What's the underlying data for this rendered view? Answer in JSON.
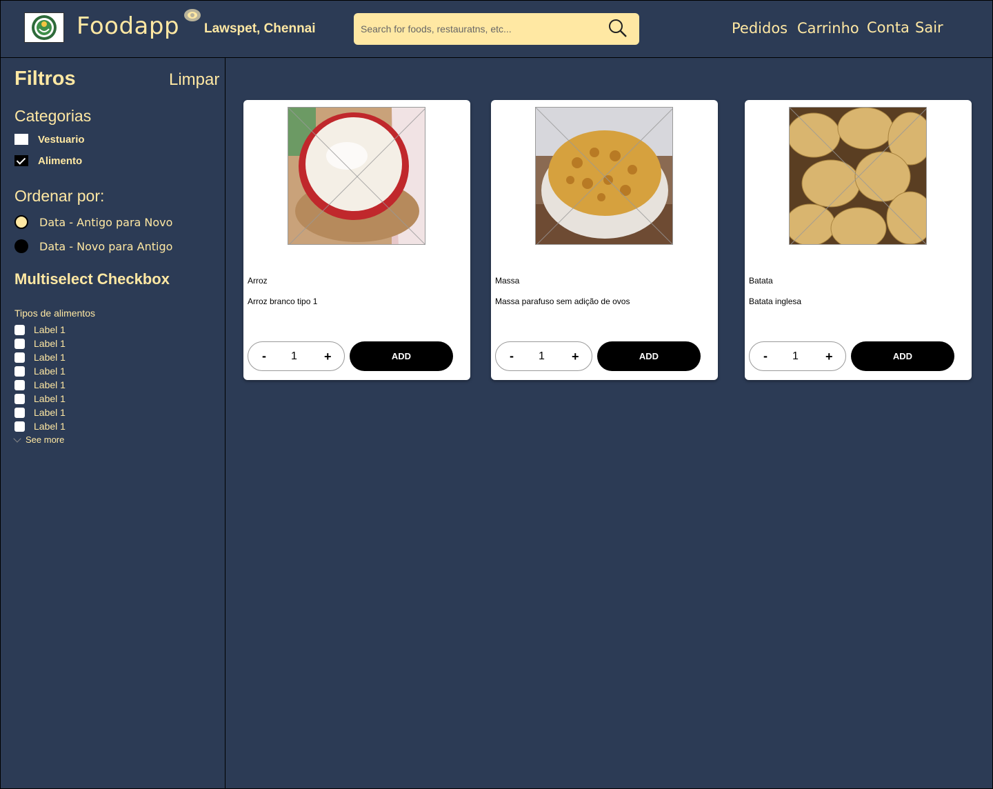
{
  "header": {
    "brand": "Foodapp",
    "location": "Lawspet, Chennai",
    "search_placeholder": "Search for foods, restauratns, etc...",
    "nav": [
      "Pedidos",
      "Carrinho",
      "Conta",
      "Sair"
    ]
  },
  "sidebar": {
    "title": "Filtros",
    "clear": "Limpar",
    "categories_title": "Categorias",
    "categories": [
      {
        "label": "Vestuario",
        "checked": false
      },
      {
        "label": "Alimento",
        "checked": true
      }
    ],
    "sort_title": "Ordenar por:",
    "sort_options": [
      {
        "label": "Data - Antigo para Novo",
        "selected": true
      },
      {
        "label": "Data - Novo para Antigo",
        "selected": false
      }
    ],
    "multiselect_title": "Multiselect Checkbox",
    "multiselect_sub": "Tipos de alimentos",
    "multiselect_items": [
      "Label 1",
      "Label 1",
      "Label 1",
      "Label 1",
      "Label 1",
      "Label 1",
      "Label 1",
      "Label 1"
    ],
    "see_more": "See more"
  },
  "products": [
    {
      "name": "Arroz",
      "description": "Arroz branco tipo 1",
      "qty": "1",
      "minus": "-",
      "plus": "+",
      "add": "ADD",
      "image": "rice-bowl"
    },
    {
      "name": "Massa",
      "description": "Massa parafuso sem adição de ovos",
      "qty": "1",
      "minus": "-",
      "plus": "+",
      "add": "ADD",
      "image": "pasta-bowl"
    },
    {
      "name": "Batata",
      "description": "Batata inglesa",
      "qty": "1",
      "minus": "-",
      "plus": "+",
      "add": "ADD",
      "image": "potatoes"
    }
  ],
  "colors": {
    "background": "#2c3b55",
    "accent": "#ffe8a3",
    "button": "#000000"
  }
}
